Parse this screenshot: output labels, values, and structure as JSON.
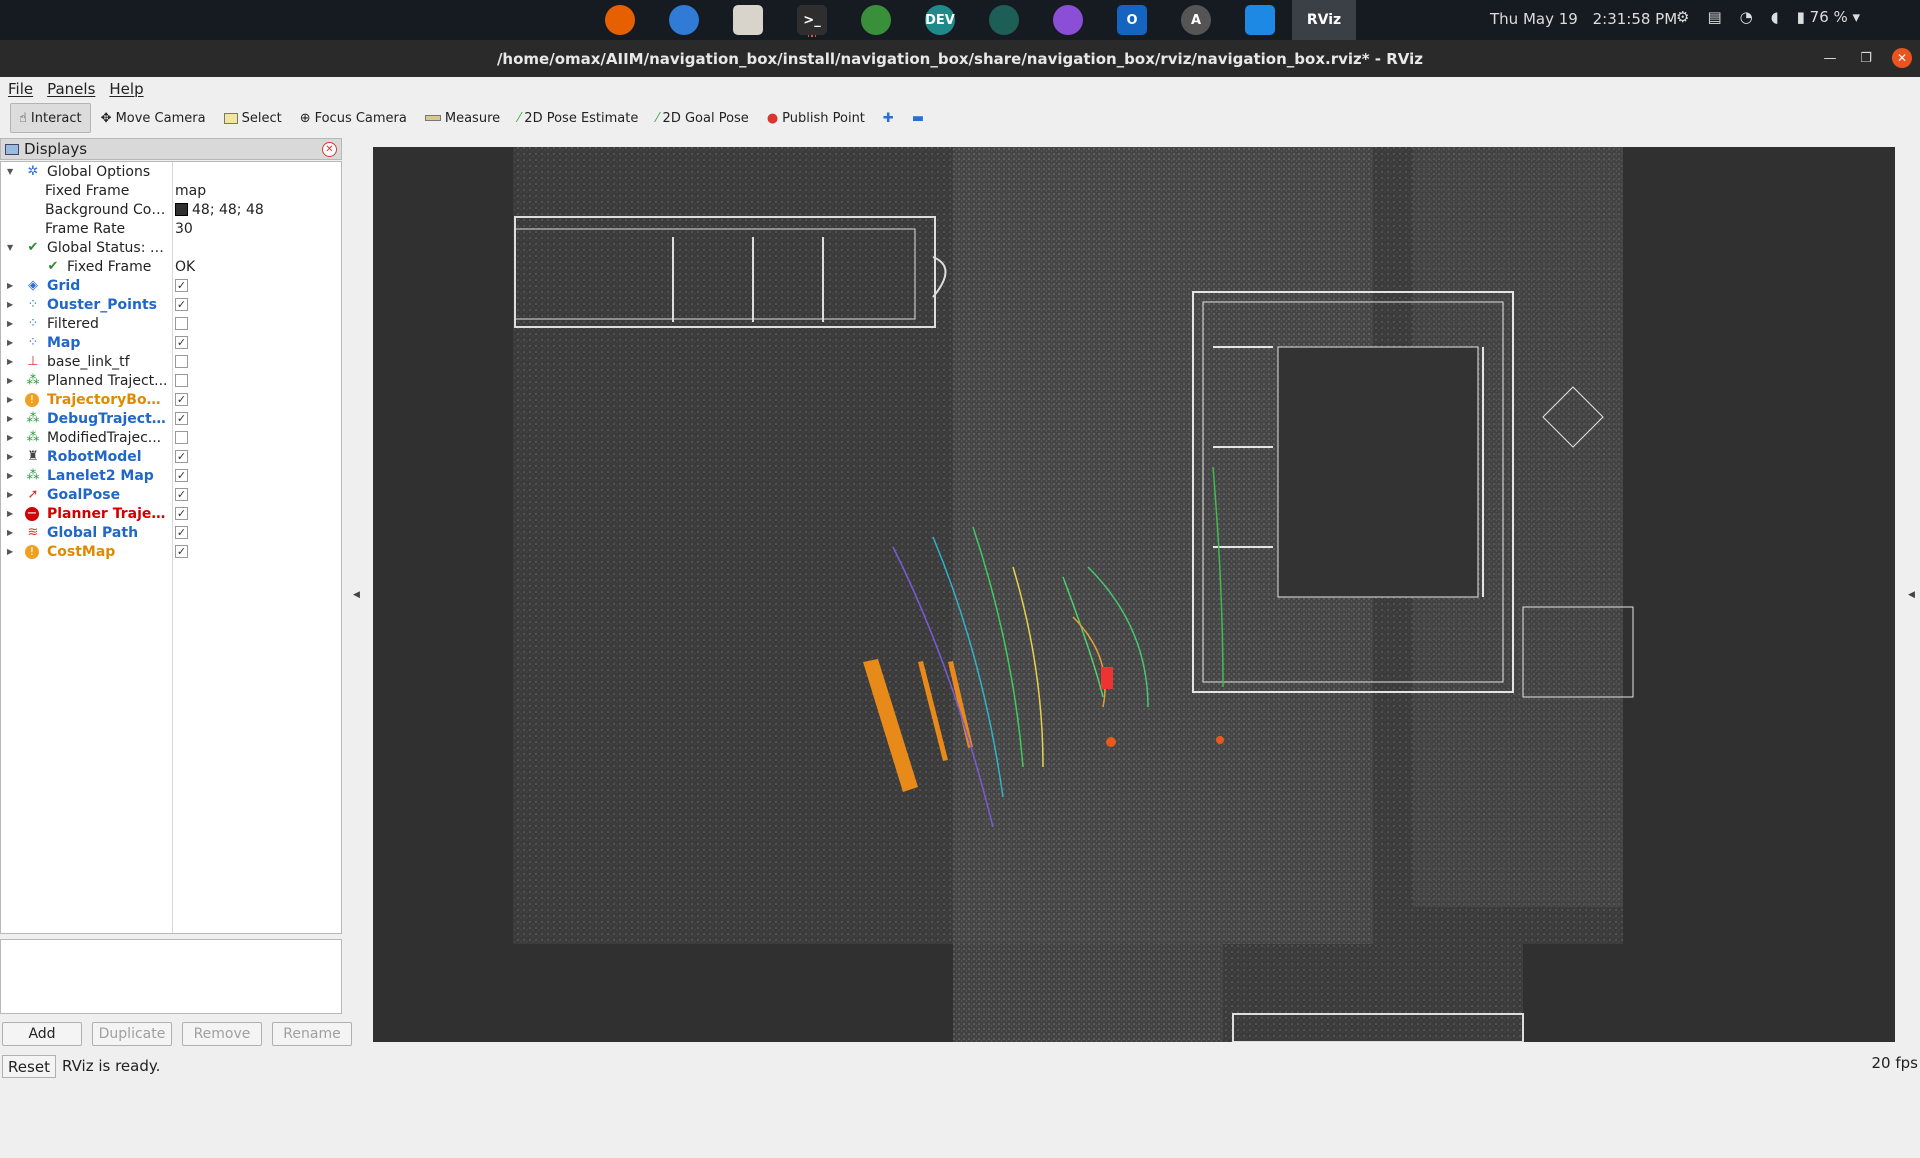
{
  "topbar": {
    "dock": [
      {
        "name": "firefox",
        "label": "",
        "color": "#e66000"
      },
      {
        "name": "thunderbird",
        "label": "",
        "color": "#2f7bd6"
      },
      {
        "name": "files",
        "label": "",
        "color": "#d8d4cc"
      },
      {
        "name": "terminal",
        "label": ">_",
        "color": "#2e2e2e"
      },
      {
        "name": "chrome",
        "label": "",
        "color": "#3a8f3a"
      },
      {
        "name": "edge-dev",
        "label": "DEV",
        "color": "#1f8a8a"
      },
      {
        "name": "gitkraken",
        "label": "",
        "color": "#1d5e57"
      },
      {
        "name": "github",
        "label": "",
        "color": "#8a4fd6"
      },
      {
        "name": "outlook",
        "label": "O",
        "color": "#1565c0"
      },
      {
        "name": "app-center",
        "label": "A",
        "color": "#555"
      },
      {
        "name": "vscode",
        "label": "",
        "color": "#1e88e5"
      },
      {
        "name": "rviz",
        "label": "RViz",
        "color": "#3b3f46"
      }
    ],
    "date": "Thu May 19",
    "time": "2:31:58 PM",
    "battery": "76 %"
  },
  "window": {
    "title": "/home/omax/AIIM/navigation_box/install/navigation_box/share/navigation_box/rviz/navigation_box.rviz* - RViz"
  },
  "menu": {
    "file": "File",
    "panels": "Panels",
    "help": "Help"
  },
  "toolbar": {
    "interact": "Interact",
    "move_camera": "Move Camera",
    "select": "Select",
    "focus_camera": "Focus Camera",
    "measure": "Measure",
    "pose_estimate": "2D Pose Estimate",
    "goal_pose": "2D Goal Pose",
    "publish_point": "Publish Point"
  },
  "displays": {
    "title": "Displays",
    "rows": [
      {
        "name": "Global Options",
        "value": "",
        "level": 0,
        "expanded": true,
        "icon": "gear-icon",
        "style": "normal",
        "checkbox": null
      },
      {
        "name": "Fixed Frame",
        "value": "map",
        "level": 1,
        "style": "normal",
        "checkbox": null
      },
      {
        "name": "Background Color",
        "value": "48; 48; 48",
        "level": 1,
        "style": "normal",
        "checkbox": null,
        "swatch": "#303030"
      },
      {
        "name": "Frame Rate",
        "value": "30",
        "level": 1,
        "style": "normal",
        "checkbox": null
      },
      {
        "name": "Global Status: Ok",
        "value": "",
        "level": 0,
        "expanded": true,
        "icon": "check-icon",
        "style": "normal",
        "checkbox": null
      },
      {
        "name": "Fixed Frame",
        "value": "OK",
        "level": 1,
        "icon": "check-icon",
        "style": "normal",
        "checkbox": null
      },
      {
        "name": "Grid",
        "level": 0,
        "icon": "grid-icon",
        "style": "blue",
        "checkbox": true
      },
      {
        "name": "Ouster_Points",
        "level": 0,
        "icon": "pointcloud-icon",
        "style": "blue",
        "checkbox": true
      },
      {
        "name": "Filtered",
        "level": 0,
        "icon": "pointcloud-icon",
        "style": "normal",
        "checkbox": false
      },
      {
        "name": "Map",
        "level": 0,
        "icon": "map-icon",
        "style": "blue",
        "checkbox": true
      },
      {
        "name": "base_link_tf",
        "level": 0,
        "icon": "axes-icon",
        "style": "normal",
        "checkbox": false
      },
      {
        "name": "Planned Traject...",
        "level": 0,
        "icon": "marker-icon",
        "style": "normal",
        "checkbox": false
      },
      {
        "name": "TrajectoryBou...",
        "level": 0,
        "icon": "warning-icon",
        "style": "orange",
        "checkbox": true
      },
      {
        "name": "DebugTrajecto...",
        "level": 0,
        "icon": "marker-icon",
        "style": "blue",
        "checkbox": true
      },
      {
        "name": "ModifiedTrajec...",
        "level": 0,
        "icon": "marker-icon",
        "style": "normal",
        "checkbox": false
      },
      {
        "name": "RobotModel",
        "level": 0,
        "icon": "robot-icon",
        "style": "blue",
        "checkbox": true
      },
      {
        "name": "Lanelet2 Map",
        "level": 0,
        "icon": "marker-icon",
        "style": "blue",
        "checkbox": true
      },
      {
        "name": "GoalPose",
        "level": 0,
        "icon": "arrow-icon",
        "style": "blue",
        "checkbox": true
      },
      {
        "name": "Planner Trajec...",
        "level": 0,
        "icon": "error-icon",
        "style": "red",
        "checkbox": true
      },
      {
        "name": "Global Path",
        "level": 0,
        "icon": "path-icon",
        "style": "blue",
        "checkbox": true
      },
      {
        "name": "CostMap",
        "level": 0,
        "icon": "warning-icon",
        "style": "orange",
        "checkbox": true
      }
    ],
    "buttons": {
      "add": "Add",
      "duplicate": "Duplicate",
      "remove": "Remove",
      "rename": "Rename"
    }
  },
  "status": {
    "reset": "Reset",
    "message": "RViz is ready.",
    "fps": "20 fps"
  }
}
